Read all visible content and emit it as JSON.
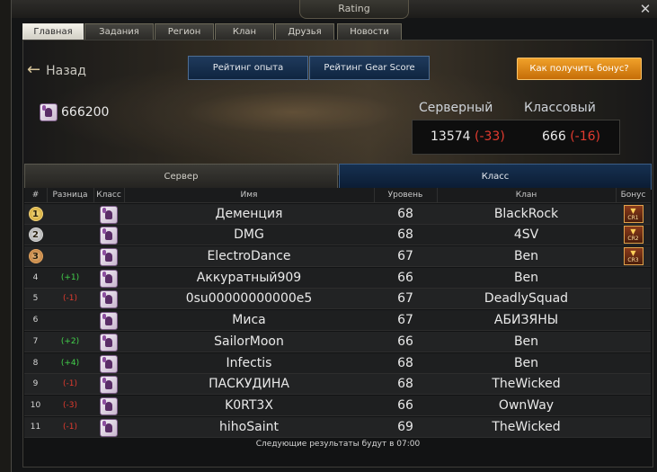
{
  "window": {
    "title": "Rating",
    "close_glyph": "✕"
  },
  "tabs": [
    {
      "label": "Главная",
      "active": true
    },
    {
      "label": "Задания",
      "active": false
    },
    {
      "label": "Регион",
      "active": false
    },
    {
      "label": "Клан",
      "active": false
    },
    {
      "label": "Друзья",
      "active": false
    },
    {
      "label": "Новости",
      "active": false
    }
  ],
  "header": {
    "back_label": "Назад",
    "btn_exp": "Рейтинг опыта",
    "btn_gear": "Рейтинг Gear Score",
    "btn_bonus": "Как получить бонус?",
    "score": "666200",
    "server_label": "Серверный",
    "class_label": "Классовый",
    "server_value": "13574",
    "server_delta": "(-33)",
    "class_value": "666",
    "class_delta": "(-16)"
  },
  "subtabs": {
    "server": "Сервер",
    "class": "Класс",
    "active": "class"
  },
  "table": {
    "columns": {
      "num": "#",
      "diff": "Разница",
      "class": "Класс",
      "name": "Имя",
      "level": "Уровень",
      "clan": "Клан",
      "bonus": "Бонус"
    },
    "rows": [
      {
        "rank": "1",
        "medal": "gold",
        "diff": "",
        "name": "Деменция",
        "level": "68",
        "clan": "BlackRock",
        "bonus": "CR1"
      },
      {
        "rank": "2",
        "medal": "silver",
        "diff": "",
        "name": "DMG",
        "level": "68",
        "clan": "4SV",
        "bonus": "CR2"
      },
      {
        "rank": "3",
        "medal": "bronze",
        "diff": "",
        "name": "ElectroDance",
        "level": "67",
        "clan": "Ben",
        "bonus": "CR3"
      },
      {
        "rank": "4",
        "medal": "",
        "diff": "(+1)",
        "name": "Аккуратный909",
        "level": "66",
        "clan": "Ben",
        "bonus": ""
      },
      {
        "rank": "5",
        "medal": "",
        "diff": "(-1)",
        "name": "0su00000000000e5",
        "level": "67",
        "clan": "DeadlySquad",
        "bonus": ""
      },
      {
        "rank": "6",
        "medal": "",
        "diff": "",
        "name": "Миса",
        "level": "67",
        "clan": "АБИЗЯНЫ",
        "bonus": ""
      },
      {
        "rank": "7",
        "medal": "",
        "diff": "(+2)",
        "name": "SailorMoon",
        "level": "66",
        "clan": "Ben",
        "bonus": ""
      },
      {
        "rank": "8",
        "medal": "",
        "diff": "(+4)",
        "name": "Infectis",
        "level": "68",
        "clan": "Ben",
        "bonus": ""
      },
      {
        "rank": "9",
        "medal": "",
        "diff": "(-1)",
        "name": "ПАСКУДИНА",
        "level": "68",
        "clan": "TheWicked",
        "bonus": ""
      },
      {
        "rank": "10",
        "medal": "",
        "diff": "(-3)",
        "name": "K0RT3X",
        "level": "66",
        "clan": "OwnWay",
        "bonus": ""
      },
      {
        "rank": "11",
        "medal": "",
        "diff": "(-1)",
        "name": "hihoSaint",
        "level": "69",
        "clan": "TheWicked",
        "bonus": ""
      }
    ]
  },
  "footer": "Следующие результаты будут в 07:00",
  "colors": {
    "positive": "#43d14b",
    "negative": "#e23b2f",
    "bonus_button": "#e08a1a",
    "accent_blue": "#163050"
  }
}
